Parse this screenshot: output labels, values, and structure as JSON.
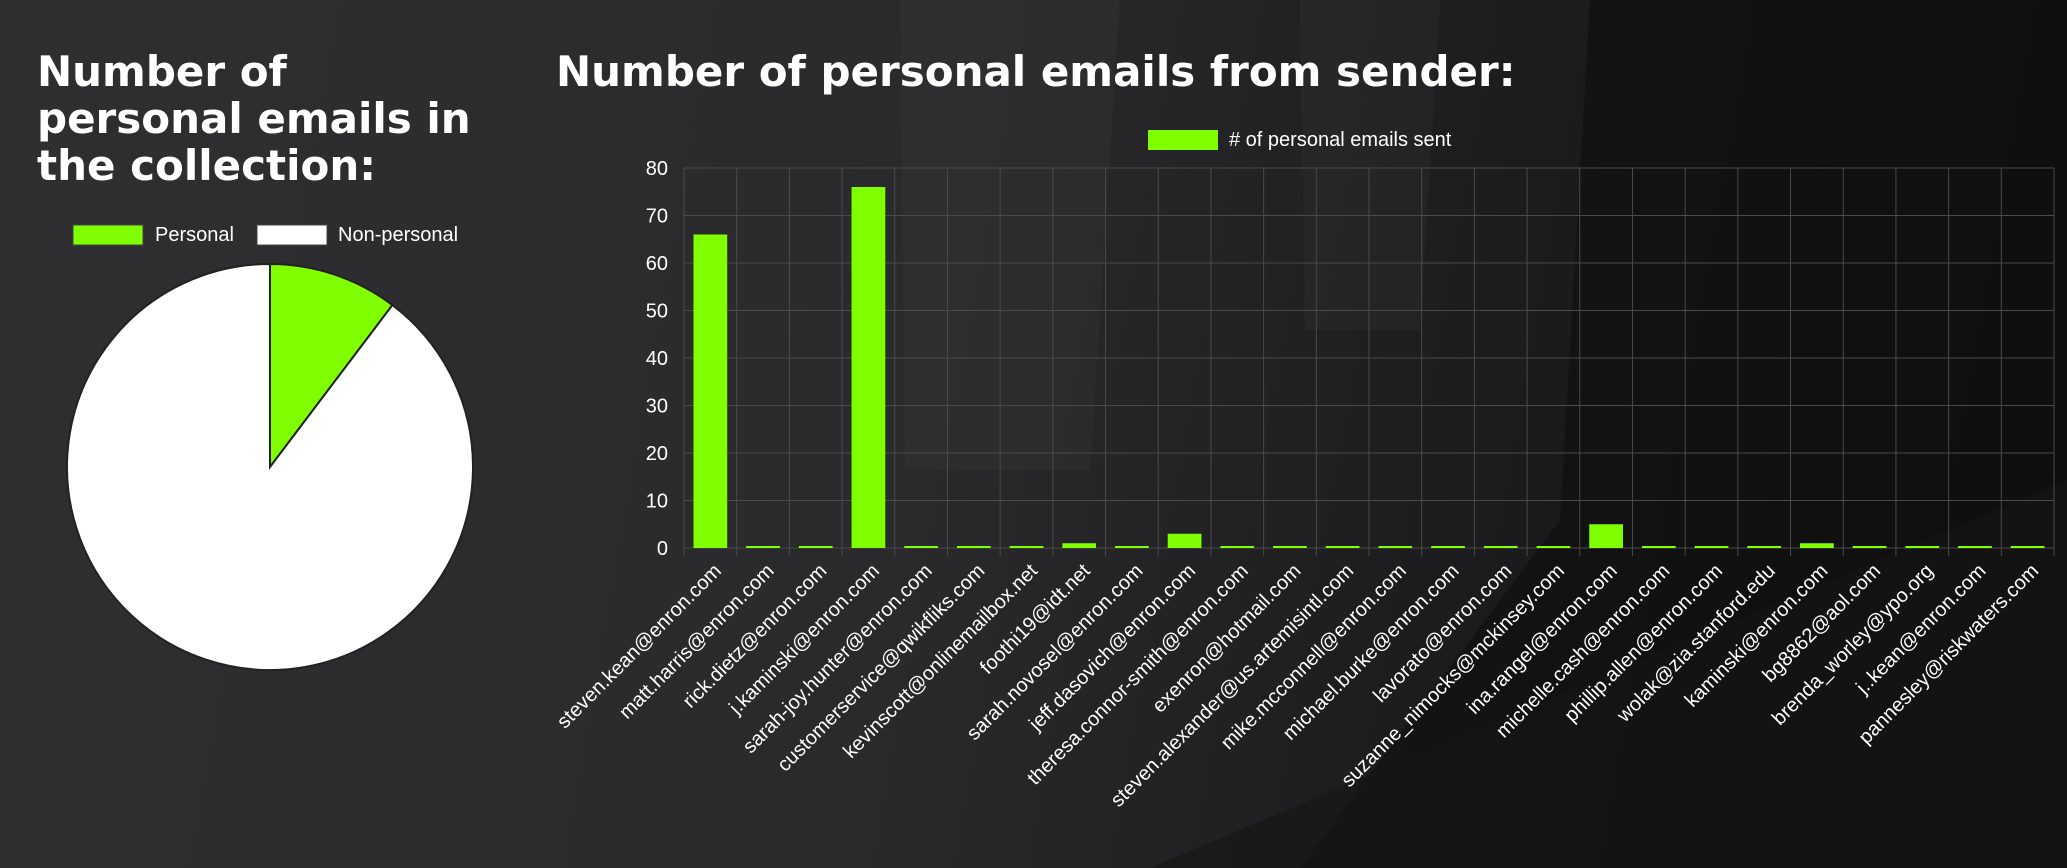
{
  "left_chart": {
    "title": "Number of personal emails in the collection:"
  },
  "right_chart": {
    "title": "Number of personal emails from sender:"
  },
  "colors": {
    "accent": "#80ff00",
    "white": "#ffffff",
    "text": "#ffffff",
    "grid": "#4a4a4a"
  },
  "chart_data": [
    {
      "type": "pie",
      "legend": [
        "Personal",
        "Non-personal"
      ],
      "legend_position": "top",
      "slices": [
        {
          "label": "Personal",
          "value": 10.3,
          "color": "#80ff00"
        },
        {
          "label": "Non-personal",
          "value": 89.7,
          "color": "#ffffff"
        }
      ]
    },
    {
      "type": "bar",
      "legend": [
        "# of personal emails sent"
      ],
      "legend_position": "top",
      "ylim": [
        0,
        80
      ],
      "yticks": [
        0,
        10,
        20,
        30,
        40,
        50,
        60,
        70,
        80
      ],
      "grid": true,
      "categories": [
        "steven.kean@enron.com",
        "matt.harris@enron.com",
        "rick.dietz@enron.com",
        "j.kaminski@enron.com",
        "sarah-joy.hunter@enron.com",
        "customerservice@qwikfliks.com",
        "kevinscott@onlinemailbox.net",
        "foothi19@idt.net",
        "sarah.novosel@enron.com",
        "jeff.dasovich@enron.com",
        "theresa.connor-smith@enron.com",
        "exenron@hotmail.com",
        "steven.alexander@us.artemisintl.com",
        "mike.mcconnell@enron.com",
        "michael.burke@enron.com",
        "lavorato@enron.com",
        "suzanne_nimocks@mckinsey.com",
        "ina.rangel@enron.com",
        "michelle.cash@enron.com",
        "phillip.allen@enron.com",
        "wolak@zia.stanford.edu",
        "kaminski@enron.com",
        "bg8862@aol.com",
        "brenda_worley@ypo.org",
        "j..kean@enron.com",
        "pannesley@riskwaters.com"
      ],
      "series": [
        {
          "name": "# of personal emails sent",
          "values": [
            66,
            0,
            0,
            76,
            0,
            0,
            0,
            1,
            0,
            3,
            0,
            0,
            0,
            0,
            0,
            0,
            0,
            5,
            0,
            0,
            0,
            1,
            0,
            0,
            0,
            0
          ]
        }
      ]
    }
  ]
}
